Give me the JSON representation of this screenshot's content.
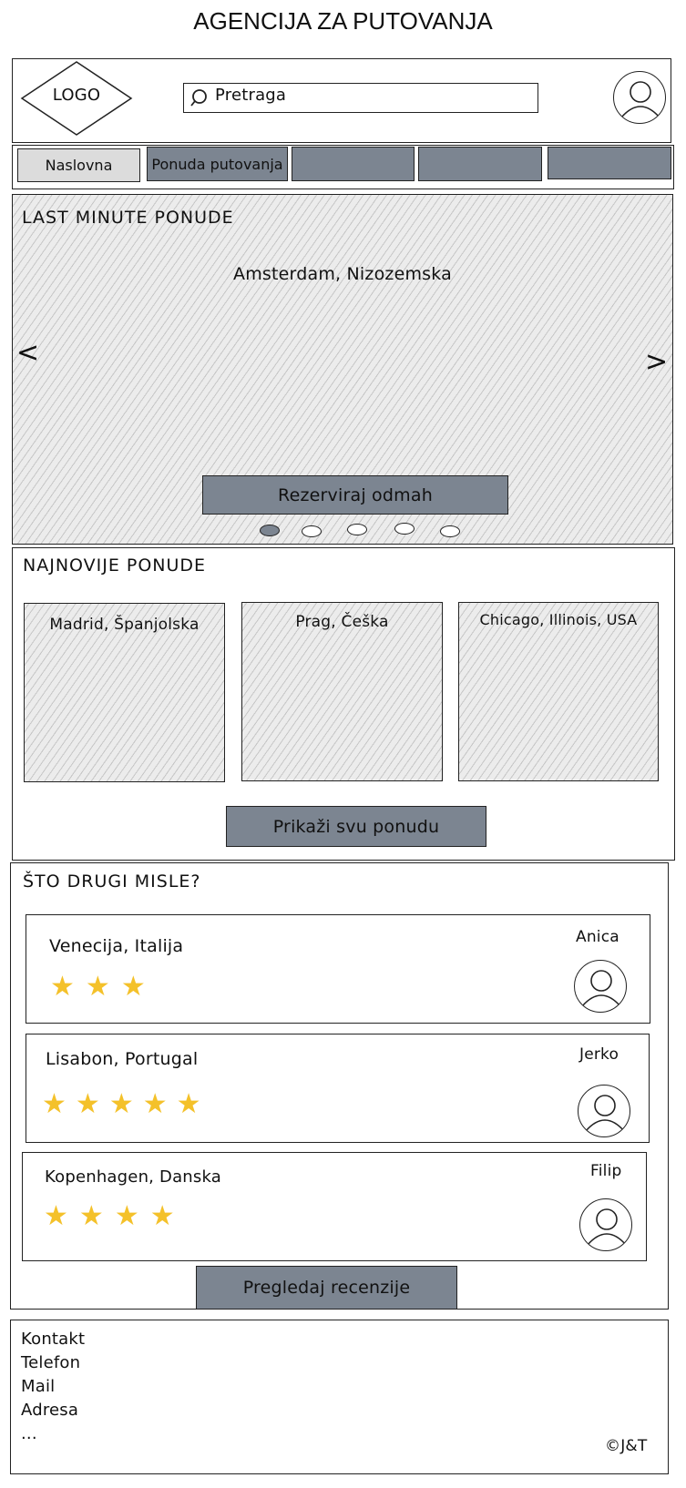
{
  "page_title": "AGENCIJA ZA PUTOVANJA",
  "header": {
    "logo": "LOGO",
    "search_placeholder": "Pretraga"
  },
  "nav": {
    "items": [
      "Naslovna",
      "Ponuda putovanja",
      "",
      "",
      ""
    ]
  },
  "last_minute": {
    "title": "LAST MINUTE PONUDE",
    "destination": "Amsterdam, Nizozemska",
    "prev": "<",
    "next": ">",
    "button": "Rezerviraj odmah",
    "slide_count": 5,
    "active_slide": 1
  },
  "newest": {
    "title": "NAJNOVIJE PONUDE",
    "cards": [
      "Madrid, Španjolska",
      "Prag, Češka",
      "Chicago, Illinois, USA"
    ],
    "button": "Prikaži svu ponudu"
  },
  "reviews": {
    "title": "ŠTO DRUGI MISLE?",
    "items": [
      {
        "place": "Venecija, Italija",
        "user": "Anica",
        "stars": 3
      },
      {
        "place": "Lisabon, Portugal",
        "user": "Jerko",
        "stars": 5
      },
      {
        "place": "Kopenhagen, Danska",
        "user": "Filip",
        "stars": 4
      }
    ],
    "button": "Pregledaj recenzije"
  },
  "footer": {
    "lines": [
      "Kontakt",
      "Telefon",
      "Mail",
      "Adresa",
      "..."
    ],
    "copyright": "©J&T"
  },
  "colors": {
    "button_gray": "#7c8591",
    "star": "#f4c12a"
  }
}
